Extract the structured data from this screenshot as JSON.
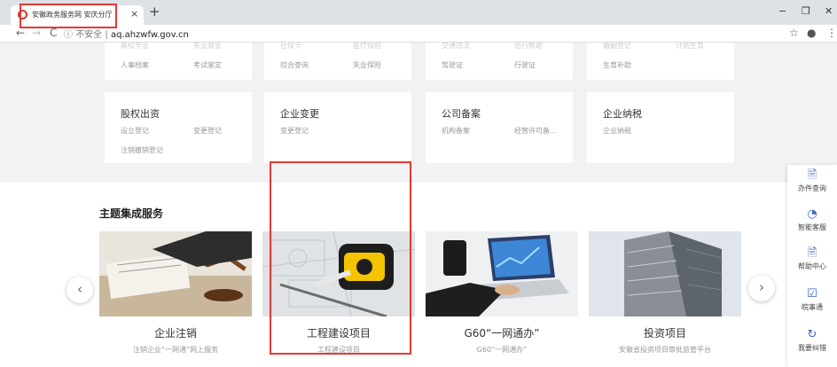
{
  "browser": {
    "tab_title": "安徽政务服务网 安庆分厅",
    "tab_close": "×",
    "new_tab": "+",
    "nav": {
      "back": "←",
      "forward": "→",
      "reload": "C"
    },
    "address": {
      "insecure_label": "不安全",
      "separator": "|",
      "url": "aq.ahzwfw.gov.cn"
    },
    "icons": [
      "star-icon",
      "account-icon",
      "menu-icon"
    ],
    "window_controls": {
      "minimize": "−",
      "restore": "❐",
      "close": "✕"
    }
  },
  "top_cards_row1": [
    {
      "links_top": [
        "高校毕业",
        "失业就业"
      ],
      "links": [
        "人事档案",
        "考试鉴定"
      ]
    },
    {
      "links_top": [
        "社保卡",
        "医疗保险"
      ],
      "links": [
        "综合查询",
        "失业保险"
      ]
    },
    {
      "links_top": [
        "交通违法",
        "出行帮助"
      ],
      "links": [
        "驾驶证",
        "行驶证"
      ]
    },
    {
      "links_top": [
        "婚姻登记",
        "计划生育"
      ],
      "links": [
        "生育补助"
      ]
    }
  ],
  "top_cards_row2": [
    {
      "title": "股权出资",
      "links": [
        "设立登记",
        "变更登记",
        "注销撤销登记"
      ]
    },
    {
      "title": "企业变更",
      "links": [
        "变更登记"
      ]
    },
    {
      "title": "公司备案",
      "links": [
        "机构备案",
        "经营许可备..."
      ]
    },
    {
      "title": "企业纳税",
      "links": [
        "企业纳税"
      ]
    }
  ],
  "section": {
    "title": "主题集成服务",
    "prev": "‹",
    "next": "›",
    "services": [
      {
        "title": "企业注销",
        "subtitle": "注销企业“一网通”网上服务"
      },
      {
        "title": "工程建设项目",
        "subtitle": "工程建设项目"
      },
      {
        "title": "G60“一网通办”",
        "subtitle": "G60“一网通办”"
      },
      {
        "title": "投资项目",
        "subtitle": "安徽省投资项目审批监管平台"
      }
    ]
  },
  "sidebar": [
    {
      "icon": "document-search-icon",
      "glyph": "🗎",
      "label": "办件查询"
    },
    {
      "icon": "service-robot-icon",
      "glyph": "◔",
      "label": "智能客服"
    },
    {
      "icon": "help-icon",
      "glyph": "🗎",
      "label": "帮助中心"
    },
    {
      "icon": "monitor-check-icon",
      "glyph": "☑",
      "label": "皖事通"
    },
    {
      "icon": "refresh-icon",
      "glyph": "↻",
      "label": "我要纠错"
    }
  ],
  "colors": {
    "highlight_red": "#e53935",
    "accent_blue": "#3a64c8"
  }
}
